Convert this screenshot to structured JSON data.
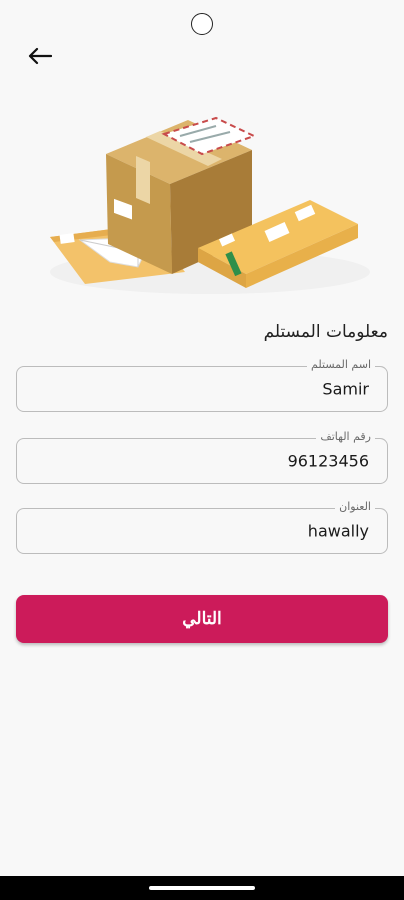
{
  "header": {
    "back_icon": "arrow-left-icon"
  },
  "illustration": {
    "name": "packages-illustration"
  },
  "form": {
    "title": "معلومات المستلم",
    "fields": [
      {
        "label": "اسم المستلم",
        "value": "Samir"
      },
      {
        "label": "رقم الهاتف",
        "value": "96123456"
      },
      {
        "label": "العنوان",
        "value": "hawally"
      }
    ]
  },
  "actions": {
    "next_label": "التالي"
  },
  "colors": {
    "primary": "#cc1b5a",
    "background": "#f8f8f8",
    "border": "#bcbcbc"
  }
}
